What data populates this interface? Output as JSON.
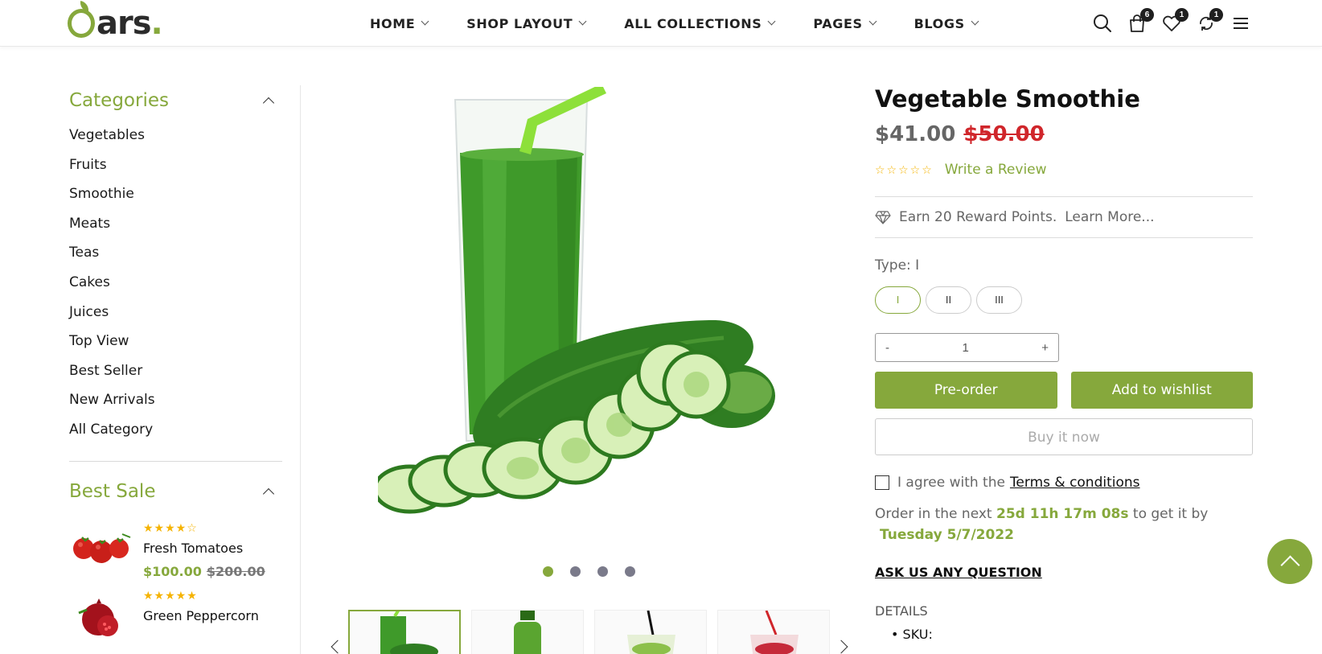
{
  "header": {
    "logo_text": "ars",
    "logo_dot": ".",
    "nav": [
      "HOME",
      "SHOP LAYOUT",
      "ALL COLLECTIONS",
      "PAGES",
      "BLOGS"
    ],
    "icons": [
      "search-icon",
      "cart-icon",
      "wishlist-icon",
      "compare-icon",
      "menu-icon"
    ],
    "cart_count": "6",
    "wishlist_count": "1",
    "compare_count": "1"
  },
  "sidebar": {
    "categories_title": "Categories",
    "categories": [
      "Vegetables",
      "Fruits",
      "Smoothie",
      "Meats",
      "Teas",
      "Cakes",
      "Juices",
      "Top View",
      "Best Seller",
      "New Arrivals",
      "All Category"
    ],
    "best_sale_title": "Best Sale",
    "best_sale": [
      {
        "name": "Fresh Tomatoes",
        "stars": "★★★★☆",
        "price": "$100.00",
        "old_price": "$200.00"
      },
      {
        "name": "Green Peppercorn",
        "stars": "★★★★★"
      }
    ]
  },
  "gallery": {
    "slide_count": 4,
    "active_slide": 1
  },
  "product": {
    "title": "Vegetable Smoothie",
    "price": "$41.00",
    "old_price": "$50.00",
    "rating_stars": "☆☆☆☆☆",
    "write_review": "Write a Review",
    "reward": "Earn 20 Reward Points.",
    "learn_more": "Learn More...",
    "type_label": "Type: I",
    "types": [
      "I",
      "II",
      "III"
    ],
    "qty_minus": "-",
    "qty_value": "1",
    "qty_plus": "+",
    "preorder": "Pre-order",
    "add_wishlist": "Add to wishlist",
    "buy_now": "Buy it now",
    "agree_text": "I agree with the",
    "terms": "Terms & conditions",
    "order_prefix": "Order in the next",
    "countdown": "25d 11h 17m 08s",
    "order_mid": "to get it by",
    "delivery_date": "Tuesday 5/7/2022",
    "ask": "ASK US ANY QUESTION",
    "details_label": "DETAILS",
    "sku_label": "SKU:"
  },
  "colors": {
    "accent": "#86a83c",
    "sale_red": "#d0262b",
    "star": "#f5b301"
  }
}
